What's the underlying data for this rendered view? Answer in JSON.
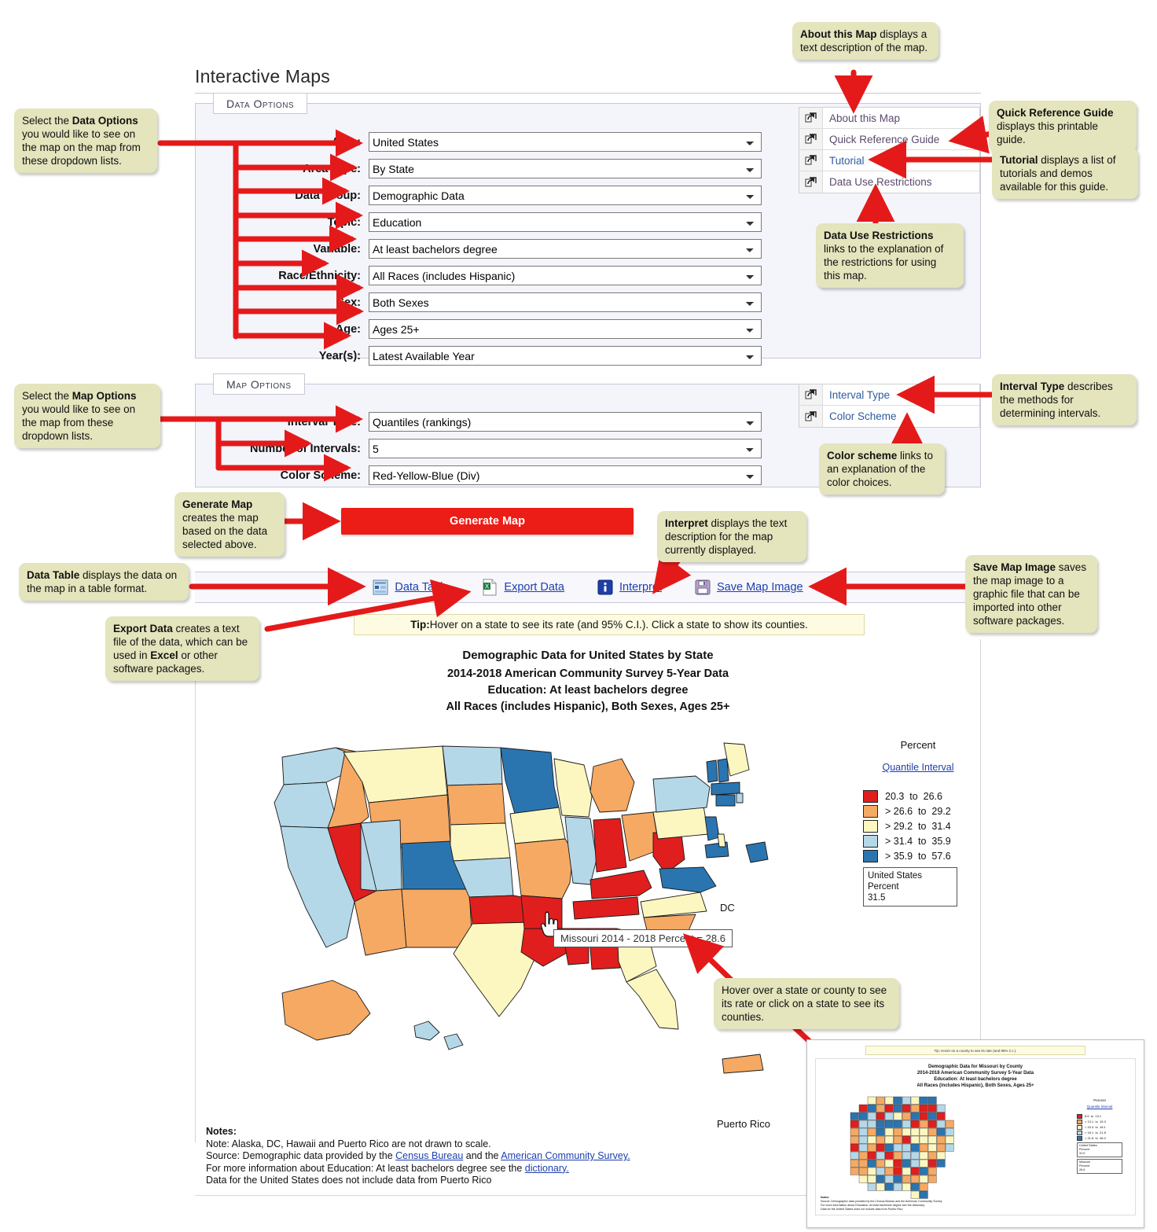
{
  "page": {
    "title": "Interactive Maps"
  },
  "data_options": {
    "tab_label": "Data Options",
    "rows": [
      {
        "label": "Area:",
        "value": "United States"
      },
      {
        "label": "Area Type:",
        "value": "By State"
      },
      {
        "label": "Data Group:",
        "value": "Demographic Data"
      },
      {
        "label": "Topic:",
        "value": "Education"
      },
      {
        "label": "Variable:",
        "value": "At least bachelors degree"
      },
      {
        "label": "Race/Ethnicity:",
        "value": "All Races (includes Hispanic)"
      },
      {
        "label": "Sex:",
        "value": "Both Sexes"
      },
      {
        "label": "Age:",
        "value": "Ages 25+"
      },
      {
        "label": "Year(s):",
        "value": "Latest Available Year"
      }
    ]
  },
  "map_options": {
    "tab_label": "Map Options",
    "rows": [
      {
        "label": "Interval Type:",
        "value": "Quantiles (rankings)"
      },
      {
        "label": "Number of Intervals:",
        "value": "5"
      },
      {
        "label": "Color Scheme:",
        "value": "Red-Yellow-Blue (Div)"
      }
    ]
  },
  "help_links": {
    "items": [
      {
        "label": "About this Map"
      },
      {
        "label": "Quick Reference Guide"
      },
      {
        "label": "Tutorial"
      },
      {
        "label": "Data Use Restrictions"
      }
    ]
  },
  "map_help_links": {
    "items": [
      {
        "label": "Interval Type"
      },
      {
        "label": "Color Scheme"
      }
    ]
  },
  "generate": {
    "label": "Generate Map"
  },
  "toolbar": {
    "items": [
      {
        "label": "Data Table",
        "icon": "table-icon"
      },
      {
        "label": "Export Data",
        "icon": "excel-icon"
      },
      {
        "label": "Interpret",
        "icon": "info-icon"
      },
      {
        "label": "Save Map Image",
        "icon": "floppy-disk-icon"
      }
    ]
  },
  "tip": {
    "prefix": "Tip:",
    "text": " Hover on a state to see its rate (and 95% C.I.).  Click a state to show its counties."
  },
  "map": {
    "title_lines": [
      "Demographic Data for United States by State",
      "2014-2018 American Community Survey 5-Year Data",
      "Education: At least bachelors degree",
      "All Races (includes Hispanic), Both Sexes, Ages 25+"
    ],
    "dc_label": "DC",
    "pr_label": "Puerto Rico",
    "tooltip": "Missouri 2014 - 2018 Percent = 28.6"
  },
  "legend": {
    "title": "Percent",
    "interval_link": "Quantile Interval",
    "entries": [
      {
        "color": "#e01e1e",
        "label": "20.3  to  26.6"
      },
      {
        "color": "#f6a963",
        "label": "> 26.6  to  29.2"
      },
      {
        "color": "#fcf6c0",
        "label": "> 29.2  to  31.4"
      },
      {
        "color": "#b5d8e8",
        "label": "> 31.4  to  35.9"
      },
      {
        "color": "#2a75b0",
        "label": "> 35.9  to  57.6"
      }
    ],
    "note": {
      "area": "United States",
      "measure": "Percent",
      "value": "31.5"
    }
  },
  "notes": {
    "heading": "Notes:",
    "line1": "Note: Alaska, DC, Hawaii and Puerto Rico are not drawn to scale.",
    "source_pre": "Source: Demographic data provided by the ",
    "source_link1": "Census Bureau",
    "source_mid": " and the ",
    "source_link2": "American Community Survey.",
    "info_pre": "For more information about Education: At least bachelors degree see the ",
    "info_link": "dictionary.",
    "line4": "Data for the United States does not include data from Puerto Rico"
  },
  "callouts": {
    "data_options": "Select the <b>Data Options</b> you would like to see on the map on the map from these dropdown lists.",
    "map_options": "Select the <b>Map Options</b> you would like to see on the map from these dropdown lists.",
    "about_map": "<b>About this Map</b> displays a text description of the map.",
    "quick_reference": "<b>Quick Reference Guide</b> displays this printable guide.",
    "tutorial": "<b>Tutorial</b> displays a list of tutorials and demos available for this guide.",
    "data_use": "<b>Data Use Restrictions</b> links to the explanation of the restrictions for using this map.",
    "interval_type": "<b>Interval Type</b> describes the methods for determining intervals.",
    "color_scheme": "<b>Color scheme</b> links to an explanation of the color choices.",
    "generate_map": "<b>Generate Map</b> creates the map based on the data selected above.",
    "interpret": "<b>Interpret</b> displays the text description for the map currently displayed.",
    "data_table": "<b>Data Table</b> displays the data on the map in a table format.",
    "export_data": "<b>Export Data</b> creates a text file of the data, which can be used in <b>Excel</b> or other software packages.",
    "save_map_image": "<b>Save Map Image</b> saves the map image to a graphic file that can be imported into other software packages.",
    "hover_state": "Hover over a state or county to see its rate or click on a state to see its counties."
  },
  "inset": {
    "tip": "Tip: Hover on a county to see its rate (and 95% C.I.).",
    "title_lines": [
      "Demographic Data for Missouri by County",
      "2014-2018 American Community Survey 5-Year Data",
      "Education: At least bachelors degree",
      "All Races (includes Hispanic), Both Sexes, Ages 25+"
    ],
    "legend_title": "Percent",
    "legend_link": "Quantile Interval",
    "legend_entries": [
      {
        "color": "#e01e1e",
        "label": "8.6  to  13.1"
      },
      {
        "color": "#f6a963",
        "label": "> 13.1  to  15.3"
      },
      {
        "color": "#fcf6c0",
        "label": "> 15.3  to  18.1"
      },
      {
        "color": "#b5d8e8",
        "label": "> 18.1  to  21.8"
      },
      {
        "color": "#2a75b0",
        "label": "> 21.8  to  46.0"
      }
    ],
    "note_us": {
      "area": "United States",
      "measure": "Percent",
      "value": "31.5"
    },
    "note_mo": {
      "area": "Missouri",
      "measure": "Percent",
      "value": "28.6"
    },
    "notes_heading": "Notes:",
    "notes_line1": "Source: Demographic data provided by the Census Bureau and the American Community Survey.",
    "notes_line2": "For more information about Education: At least bachelors degree see the dictionary.",
    "notes_line3": "Data for the United States does not include data from Puerto Rico"
  },
  "chart_data": {
    "type": "map",
    "title": "Demographic Data for United States by State",
    "subtitle": "2014-2018 American Community Survey 5-Year Data / Education: At least bachelors degree",
    "measure": "Percent",
    "interval_method": "Quantiles (rankings)",
    "num_intervals": 5,
    "color_scheme": "Red-Yellow-Blue (Div)",
    "us_value": 31.5,
    "bins": [
      {
        "range": "20.3 to 26.6",
        "color": "#e01e1e"
      },
      {
        "range": "> 26.6 to 29.2",
        "color": "#f6a963"
      },
      {
        "range": "> 29.2 to 31.4",
        "color": "#fcf6c0"
      },
      {
        "range": "> 31.4 to 35.9",
        "color": "#b5d8e8"
      },
      {
        "range": "> 35.9 to 57.6",
        "color": "#2a75b0"
      }
    ],
    "highlighted": {
      "state": "Missouri",
      "years": "2014 - 2018",
      "percent": 28.6
    },
    "states": [
      {
        "code": "WA",
        "bin": 4
      },
      {
        "code": "OR",
        "bin": 4
      },
      {
        "code": "CA",
        "bin": 4
      },
      {
        "code": "NV",
        "bin": 1
      },
      {
        "code": "ID",
        "bin": 2
      },
      {
        "code": "MT",
        "bin": 3
      },
      {
        "code": "WY",
        "bin": 2
      },
      {
        "code": "UT",
        "bin": 4
      },
      {
        "code": "CO",
        "bin": 5
      },
      {
        "code": "AZ",
        "bin": 2
      },
      {
        "code": "NM",
        "bin": 2
      },
      {
        "code": "ND",
        "bin": 4
      },
      {
        "code": "SD",
        "bin": 2
      },
      {
        "code": "NE",
        "bin": 3
      },
      {
        "code": "KS",
        "bin": 4
      },
      {
        "code": "OK",
        "bin": 1
      },
      {
        "code": "TX",
        "bin": 3
      },
      {
        "code": "MN",
        "bin": 5
      },
      {
        "code": "IA",
        "bin": 3
      },
      {
        "code": "MO",
        "bin": 2
      },
      {
        "code": "AR",
        "bin": 1
      },
      {
        "code": "LA",
        "bin": 1
      },
      {
        "code": "WI",
        "bin": 3
      },
      {
        "code": "IL",
        "bin": 4
      },
      {
        "code": "MS",
        "bin": 1
      },
      {
        "code": "AL",
        "bin": 1
      },
      {
        "code": "TN",
        "bin": 1
      },
      {
        "code": "KY",
        "bin": 1
      },
      {
        "code": "IN",
        "bin": 1
      },
      {
        "code": "MI",
        "bin": 2
      },
      {
        "code": "OH",
        "bin": 2
      },
      {
        "code": "WV",
        "bin": 1
      },
      {
        "code": "VA",
        "bin": 5
      },
      {
        "code": "NC",
        "bin": 3
      },
      {
        "code": "SC",
        "bin": 2
      },
      {
        "code": "GA",
        "bin": 3
      },
      {
        "code": "FL",
        "bin": 3
      },
      {
        "code": "PA",
        "bin": 3
      },
      {
        "code": "NY",
        "bin": 4
      },
      {
        "code": "NJ",
        "bin": 5
      },
      {
        "code": "MD",
        "bin": 5
      },
      {
        "code": "DE",
        "bin": 3
      },
      {
        "code": "DC",
        "bin": 5
      },
      {
        "code": "CT",
        "bin": 5
      },
      {
        "code": "RI",
        "bin": 4
      },
      {
        "code": "MA",
        "bin": 5
      },
      {
        "code": "VT",
        "bin": 5
      },
      {
        "code": "NH",
        "bin": 5
      },
      {
        "code": "ME",
        "bin": 3
      },
      {
        "code": "AK",
        "bin": 2
      },
      {
        "code": "HI",
        "bin": 4
      },
      {
        "code": "PR",
        "bin": 2
      }
    ]
  }
}
